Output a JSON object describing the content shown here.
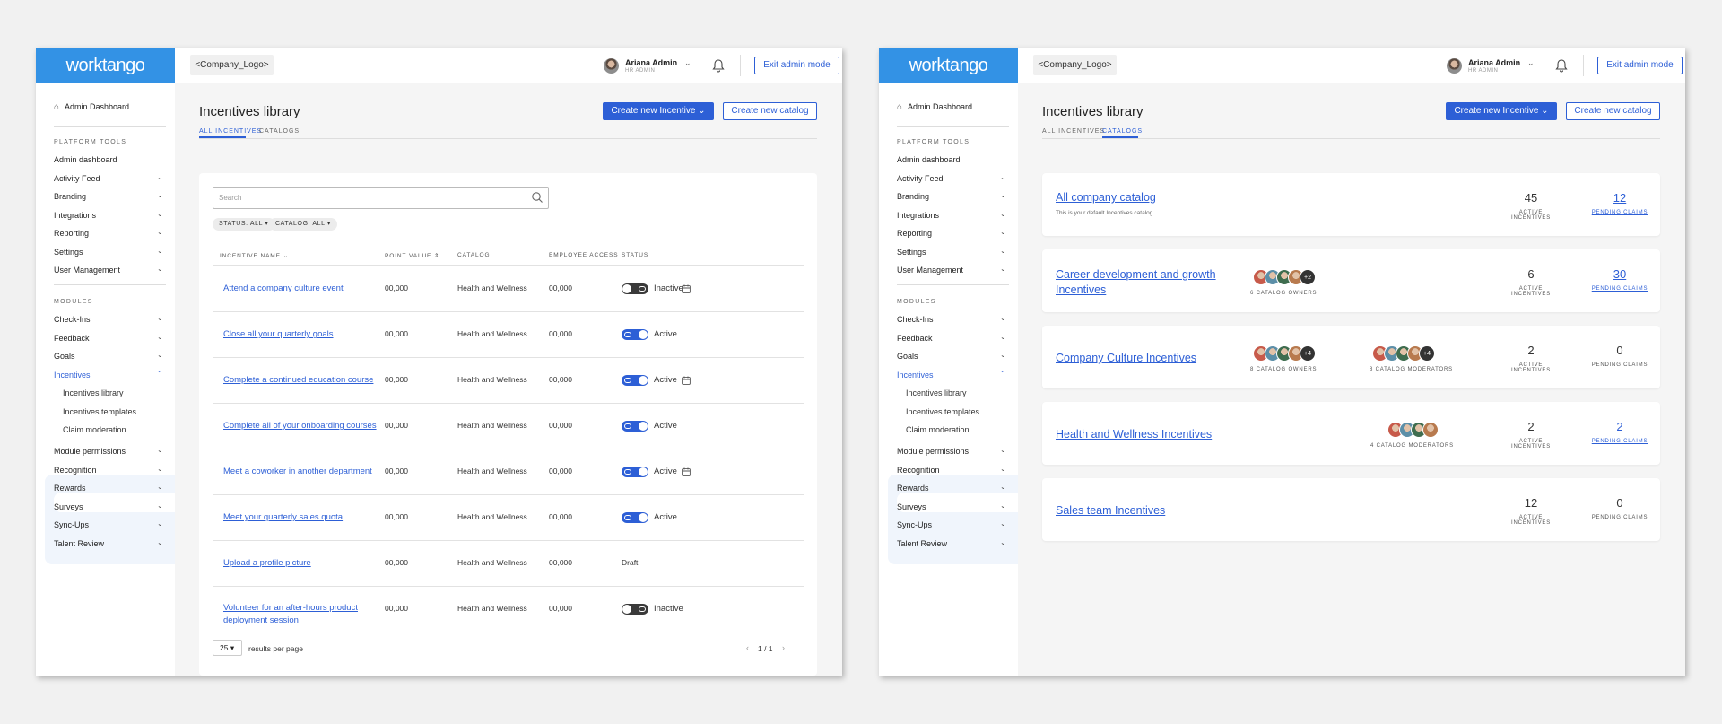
{
  "topbar": {
    "brand": "worktango",
    "company_logo": "<Company_Logo>",
    "user_name": "Ariana Admin",
    "user_role": "HR ADMIN",
    "exit_label": "Exit admin mode"
  },
  "sidebar": {
    "home": "Admin Dashboard",
    "platform_header": "PLATFORM TOOLS",
    "platform_items": [
      "Admin dashboard",
      "Activity Feed",
      "Branding",
      "Integrations",
      "Reporting",
      "Settings",
      "User Management"
    ],
    "modules_header": "MODULES",
    "module_items": [
      "Check-Ins",
      "Feedback",
      "Goals",
      "Incentives"
    ],
    "incentives_sub": [
      "Incentives library",
      "Incentives templates",
      "Claim moderation"
    ],
    "more_items": [
      "Module permissions",
      "Recognition",
      "Rewards",
      "Surveys",
      "Sync-Ups",
      "Talent Review"
    ]
  },
  "page": {
    "title": "Incentives library",
    "create_incentive": "Create new Incentive",
    "create_catalog": "Create new catalog",
    "tab_all": "ALL INCENTIVES",
    "tab_catalogs": "CATALOGS"
  },
  "table": {
    "search_placeholder": "Search",
    "filter_status": "STATUS: ALL",
    "filter_catalog": "CATALOG: ALL",
    "headers": [
      "INCENTIVE NAME",
      "POINT VALUE",
      "CATALOG",
      "EMPLOYEE ACCESS",
      "STATUS"
    ],
    "rows": [
      {
        "name": "Attend a company culture event",
        "points": "00,000",
        "catalog": "Health and Wellness",
        "access": "00,000",
        "status": "Inactive",
        "toggle": "off",
        "calendar": true
      },
      {
        "name": "Close all your quarterly goals",
        "points": "00,000",
        "catalog": "Health and Wellness",
        "access": "00,000",
        "status": "Active",
        "toggle": "on",
        "calendar": false
      },
      {
        "name": "Complete a continued education course",
        "points": "00,000",
        "catalog": "Health and Wellness",
        "access": "00,000",
        "status": "Active",
        "toggle": "on",
        "calendar": true
      },
      {
        "name": "Complete all of your onboarding courses",
        "points": "00,000",
        "catalog": "Health and Wellness",
        "access": "00,000",
        "status": "Active",
        "toggle": "on",
        "calendar": false
      },
      {
        "name": "Meet a coworker in another department",
        "points": "00,000",
        "catalog": "Health and Wellness",
        "access": "00,000",
        "status": "Active",
        "toggle": "on",
        "calendar": true
      },
      {
        "name": "Meet your quarterly sales quota",
        "points": "00,000",
        "catalog": "Health and Wellness",
        "access": "00,000",
        "status": "Active",
        "toggle": "on",
        "calendar": false
      },
      {
        "name": "Upload a profile picture",
        "points": "00,000",
        "catalog": "Health and Wellness",
        "access": "00,000",
        "status": "Draft",
        "toggle": "none",
        "calendar": false
      },
      {
        "name": "Volunteer for an after-hours product deployment session",
        "points": "00,000",
        "catalog": "Health and Wellness",
        "access": "00,000",
        "status": "Inactive",
        "toggle": "off",
        "calendar": false
      }
    ],
    "per_page": "25",
    "per_page_label": "results per page",
    "page_info": "1 / 1"
  },
  "catalogs": [
    {
      "title": "All company catalog",
      "subtitle": "This is your default Incentives catalog",
      "owners": null,
      "owners_more": "",
      "owners_label": "",
      "mods": null,
      "mods_more": "",
      "mods_label": "",
      "active": "45",
      "active_label": "ACTIVE INCENTIVES",
      "pending": "12",
      "pending_label": "PENDING CLAIMS",
      "pending_link": true
    },
    {
      "title": "Career development and growth Incentives",
      "subtitle": "",
      "owners": 4,
      "owners_more": "+2",
      "owners_label": "6 CATALOG OWNERS",
      "mods": null,
      "mods_more": "",
      "mods_label": "",
      "active": "6",
      "active_label": "ACTIVE INCENTIVES",
      "pending": "30",
      "pending_label": "PENDING CLAIMS",
      "pending_link": true
    },
    {
      "title": "Company Culture Incentives",
      "subtitle": "",
      "owners": 4,
      "owners_more": "+4",
      "owners_label": "8 CATALOG OWNERS",
      "mods": 4,
      "mods_more": "+4",
      "mods_label": "8 CATALOG MODERATORS",
      "active": "2",
      "active_label": "ACTIVE INCENTIVES",
      "pending": "0",
      "pending_label": "PENDING CLAIMS",
      "pending_link": false
    },
    {
      "title": "Health and Wellness Incentives",
      "subtitle": "",
      "owners": null,
      "owners_more": "",
      "owners_label": "",
      "mods": 4,
      "mods_more": "",
      "mods_label": "4 CATALOG MODERATORS",
      "active": "2",
      "active_label": "ACTIVE INCENTIVES",
      "pending": "2",
      "pending_label": "PENDING CLAIMS",
      "pending_link": true
    },
    {
      "title": "Sales team Incentives",
      "subtitle": "",
      "owners": null,
      "owners_more": "",
      "owners_label": "",
      "mods": null,
      "mods_more": "",
      "mods_label": "",
      "active": "12",
      "active_label": "ACTIVE INCENTIVES",
      "pending": "0",
      "pending_label": "PENDING CLAIMS",
      "pending_link": false
    }
  ],
  "colors": {
    "brand": "#3392e5",
    "accent": "#2d5fd6",
    "toggle_off": "#3a3a3a"
  }
}
